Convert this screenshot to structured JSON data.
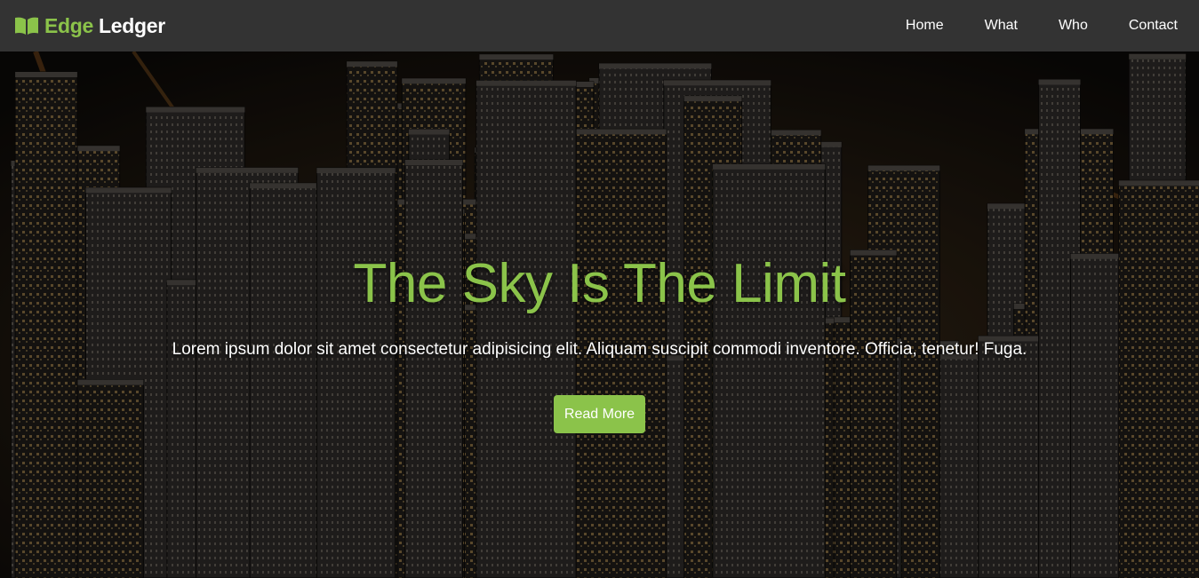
{
  "brand": {
    "part1": "Edge",
    "part2": "Ledger",
    "icon": "book-open-icon",
    "accent": "#8bc34a"
  },
  "nav": {
    "links": [
      {
        "label": "Home"
      },
      {
        "label": "What"
      },
      {
        "label": "Who"
      },
      {
        "label": "Contact"
      }
    ]
  },
  "hero": {
    "title": "The Sky Is The Limit",
    "text": "Lorem ipsum dolor sit amet consectetur adipisicing elit. Aliquam suscipit commodi inventore. Officia, tenetur! Fuga.",
    "button_label": "Read More",
    "background": "night-city-aerial-image"
  },
  "colors": {
    "navbar": "#333333",
    "accent": "#8bc34a",
    "text": "#ffffff"
  }
}
